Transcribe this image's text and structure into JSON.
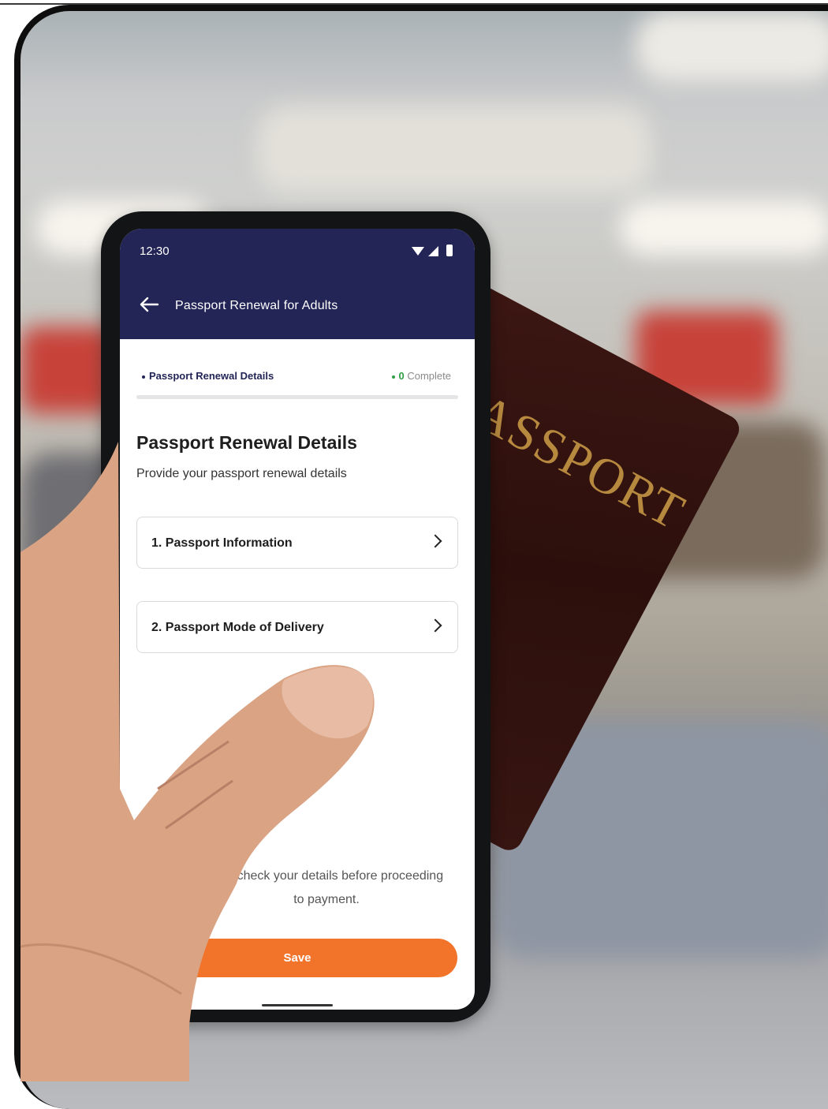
{
  "passport_cover": {
    "word": "PASSPORT"
  },
  "status_bar": {
    "time": "12:30"
  },
  "app_bar": {
    "title": "Passport Renewal for Adults"
  },
  "progress": {
    "section": "Passport Renewal Details",
    "count": "0",
    "status": "Complete"
  },
  "page": {
    "title": "Passport Renewal Details",
    "subtitle": "Provide your passport renewal details"
  },
  "cards": [
    {
      "label": "1. Passport Information"
    },
    {
      "label": "2. Passport Mode of Delivery"
    }
  ],
  "footer": {
    "note": "Please double check your details before proceeding to payment.",
    "visible_note": "uble check your details before proceeding to payment.",
    "save_label": "Save"
  },
  "colors": {
    "header": "#232557",
    "accent": "#f1742a",
    "complete": "#2f9e44"
  }
}
